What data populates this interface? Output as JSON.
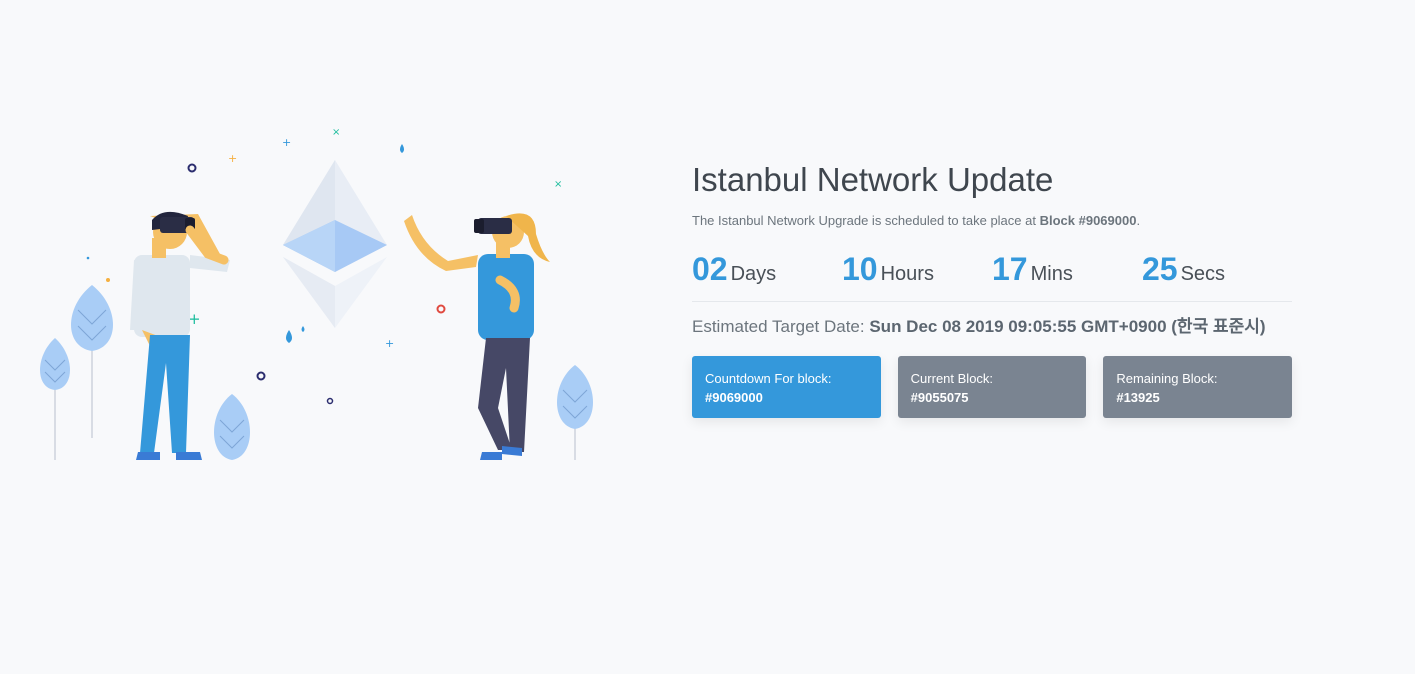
{
  "header": {
    "title": "Istanbul Network Update"
  },
  "intro": {
    "text_before": "The Istanbul Network Upgrade is scheduled to take place at ",
    "block_label": "Block #9069000",
    "text_after": "."
  },
  "countdown": [
    {
      "value": "02",
      "label": "Days"
    },
    {
      "value": "10",
      "label": "Hours"
    },
    {
      "value": "17",
      "label": "Mins"
    },
    {
      "value": "25",
      "label": "Secs"
    }
  ],
  "target": {
    "label": "Estimated Target Date: ",
    "date": "Sun Dec 08 2019 09:05:55 GMT+0900 (한국 표준시)"
  },
  "cards": [
    {
      "label": "Countdown For block:",
      "value": "#9069000"
    },
    {
      "label": "Current Block:",
      "value": "#9055075"
    },
    {
      "label": "Remaining Block:",
      "value": "#13925"
    }
  ],
  "colors": {
    "accent": "#3498db",
    "card_gray": "#7a8491",
    "background": "#f8f9fb"
  }
}
